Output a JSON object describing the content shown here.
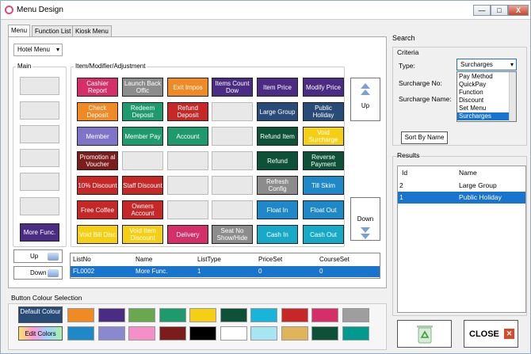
{
  "window": {
    "title": "Menu Design",
    "controls": {
      "minimize": "—",
      "maximize": "□",
      "close": "X"
    }
  },
  "tabs": [
    {
      "label": "Menu",
      "active": true
    },
    {
      "label": "Function List",
      "active": false
    },
    {
      "label": "Kiosk Menu",
      "active": false
    }
  ],
  "menu_select": {
    "value": "Hotel Menu"
  },
  "main_group": {
    "label": "Main",
    "buttons": [
      "",
      "",
      "",
      "",
      "",
      "",
      "More Func."
    ]
  },
  "item_group": {
    "label": "Item/Modifier/Adjustment",
    "rows": [
      [
        {
          "label": "Cashier Report",
          "color": "#d52f6a"
        },
        {
          "label": "Launch Back Offic",
          "color": "#8c8c8c"
        },
        {
          "label": "Exit Impos",
          "color": "#f08a24"
        },
        {
          "label": "Items Count Dow",
          "color": "#4b2c83"
        },
        {
          "label": "Item Price",
          "color": "#4b2c83"
        },
        {
          "label": "Modify Price",
          "color": "#4b2c83"
        }
      ],
      [
        {
          "label": "Check Deposit",
          "color": "#f08a24"
        },
        {
          "label": "Redeem Deposit",
          "color": "#1f9a6e"
        },
        {
          "label": "Refund Deposit",
          "color": "#c62828"
        },
        {
          "label": "",
          "color": ""
        },
        {
          "label": "Large Group",
          "color": "#294b78"
        },
        {
          "label": "Public Holiday",
          "color": "#294b78"
        }
      ],
      [
        {
          "label": "Member",
          "color": "#7f74c8"
        },
        {
          "label": "Member Pay",
          "color": "#1f9a6e"
        },
        {
          "label": "Account",
          "color": "#1f9a6e"
        },
        {
          "label": "",
          "color": ""
        },
        {
          "label": "Refund Item",
          "color": "#0e5139"
        },
        {
          "label": "Void Surcharge",
          "color": "#f5cf14"
        }
      ],
      [
        {
          "label": "Promotion al Voucher",
          "color": "#7c1d1d"
        },
        {
          "label": "",
          "color": ""
        },
        {
          "label": "",
          "color": ""
        },
        {
          "label": "",
          "color": ""
        },
        {
          "label": "Refund",
          "color": "#0e5139"
        },
        {
          "label": "Reverse Payment",
          "color": "#0e5139"
        }
      ],
      [
        {
          "label": "10% Discount",
          "color": "#c62828"
        },
        {
          "label": "Staff Discount",
          "color": "#c62828"
        },
        {
          "label": "",
          "color": ""
        },
        {
          "label": "",
          "color": ""
        },
        {
          "label": "Refresh Config",
          "color": "#8c8c8c"
        },
        {
          "label": "Till Skim",
          "color": "#1e88c8"
        }
      ],
      [
        {
          "label": "Free Coffee",
          "color": "#c62828"
        },
        {
          "label": "Owners Account",
          "color": "#c62828"
        },
        {
          "label": "",
          "color": ""
        },
        {
          "label": "",
          "color": ""
        },
        {
          "label": "Float In",
          "color": "#1e88c8"
        },
        {
          "label": "Float Out",
          "color": "#1e88c8"
        }
      ],
      [
        {
          "label": "Void Bill Disc",
          "color": "#f5cf14"
        },
        {
          "label": "Void Item Discount",
          "color": "#f5cf14"
        },
        {
          "label": "Delivery",
          "color": "#d52f6a"
        },
        {
          "label": "Seat No Show/Hide",
          "color": "#8c8c8c"
        },
        {
          "label": "Cash In",
          "color": "#18a9c9"
        },
        {
          "label": "Cash Out",
          "color": "#18a9c9"
        }
      ]
    ]
  },
  "scroll_buttons": {
    "up": "Up",
    "down": "Down"
  },
  "main_nav": {
    "up": "Up",
    "down": "Down"
  },
  "list_table": {
    "headers": [
      "ListNo",
      "Name",
      "ListType",
      "PriceSet",
      "CourseSet"
    ],
    "row": [
      "FL0002",
      "More Func.",
      "1",
      "0",
      "0"
    ]
  },
  "colour_section": {
    "label": "Button Colour Selection",
    "default_colour": "Default Colour",
    "edit_colors": "Edit Colors",
    "row1": [
      "#f08a24",
      "#4b2c83",
      "#6aa84f",
      "#1f9a6e",
      "#f5cf14",
      "#0e5139",
      "#18b4d9",
      "#c62828",
      "#d52f6a",
      "#9e9e9e"
    ],
    "row2": [
      "#1e88c8",
      "#8a89cf",
      "#f48fc8",
      "#7c1d1d",
      "#000000",
      "#ffffff",
      "#a6e6f2",
      "#e0b45a",
      "#0e5139",
      "#009a8e"
    ]
  },
  "search": {
    "title": "Search",
    "criteria_label": "Criteria",
    "type_label": "Type:",
    "type_value": "Surcharges",
    "type_options": [
      "Pay Method",
      "QuickPay",
      "Function",
      "Discount",
      "Set Menu",
      "Surcharges"
    ],
    "surcharge_no_label": "Surcharge No:",
    "surcharge_name_label": "Surcharge Name:",
    "sort_button": "Sort By Name"
  },
  "results": {
    "label": "Results",
    "headers": [
      "Id",
      "Name"
    ],
    "rows": [
      {
        "id": "2",
        "name": "Large Group",
        "selected": false
      },
      {
        "id": "1",
        "name": "Public Holiday",
        "selected": true
      }
    ]
  },
  "actions": {
    "close": "CLOSE",
    "recycle_icon": "recycle-bin-icon"
  }
}
